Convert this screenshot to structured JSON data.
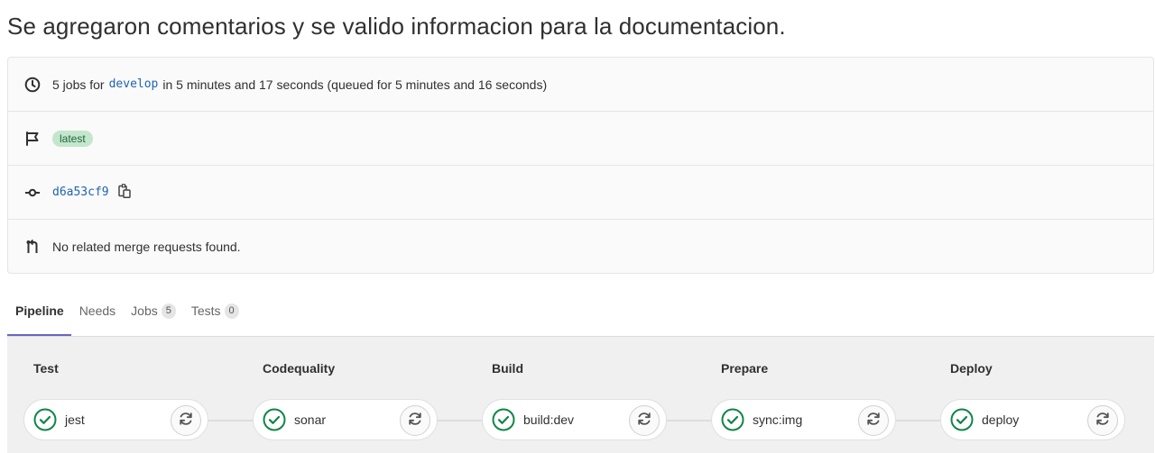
{
  "title": "Se agregaron comentarios y se valido informacion para la documentacion.",
  "info": {
    "jobs_prefix": "5 jobs for",
    "branch": "develop",
    "jobs_suffix": "in 5 minutes and 17 seconds (queued for 5 minutes and 16 seconds)",
    "tag": "latest",
    "commit_sha": "d6a53cf9",
    "merge_requests": "No related merge requests found."
  },
  "tabs": [
    {
      "label": "Pipeline",
      "count": null,
      "active": true
    },
    {
      "label": "Needs",
      "count": null
    },
    {
      "label": "Jobs",
      "count": "5"
    },
    {
      "label": "Tests",
      "count": "0"
    }
  ],
  "stages": [
    {
      "title": "Test",
      "job": "jest",
      "status": "passed"
    },
    {
      "title": "Codequality",
      "job": "sonar",
      "status": "passed"
    },
    {
      "title": "Build",
      "job": "build:dev",
      "status": "passed"
    },
    {
      "title": "Prepare",
      "job": "sync:img",
      "status": "passed"
    },
    {
      "title": "Deploy",
      "job": "deploy",
      "status": "passed"
    }
  ],
  "colors": {
    "success": "#108548",
    "link": "#1f64b0",
    "badge_bg": "#c3e6cd",
    "tab_active": "#6666c4"
  },
  "icons": {
    "clock": "clock-icon",
    "flag": "flag-icon",
    "commit": "commit-icon",
    "merge_request": "merge-request-icon",
    "copy": "copy-icon",
    "status_success": "status-success-icon",
    "retry": "retry-icon"
  }
}
